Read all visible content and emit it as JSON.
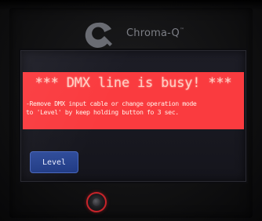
{
  "brand": {
    "name": "Chroma-Q",
    "trademark": "™",
    "logo_icon": "chroma-q-logo-icon"
  },
  "screen": {
    "alert_title": "*** DMX line is busy! ***",
    "alert_message": "-Remove DMX input cable or change operation mode\n to 'Level' by keep holding button fo 3 sec.",
    "alert_color": "#fa3b3f",
    "level_button_label": "Level"
  },
  "hardware": {
    "button_icon": "hardware-push-button-icon",
    "ring_color": "#c8242a"
  }
}
